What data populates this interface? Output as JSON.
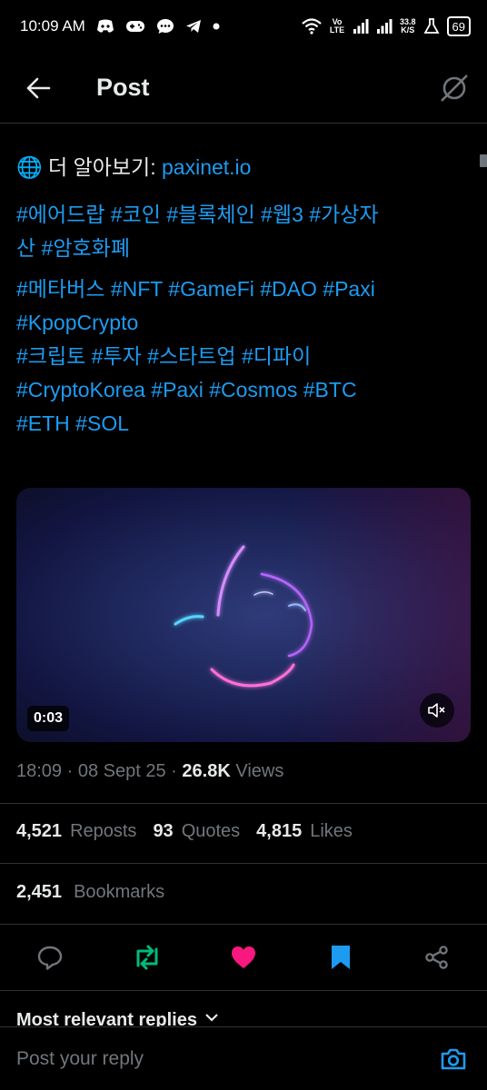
{
  "status_bar": {
    "time": "10:09 AM",
    "volte": "Vo LTE",
    "speed_value": "33.8",
    "speed_unit": "K/S",
    "battery": "69"
  },
  "header": {
    "title": "Post"
  },
  "post": {
    "learn_more_label": "🌐 더 알아보기:",
    "learn_more_link": "paxinet.io",
    "hashtag_lines": [
      "#에어드랍 #코인 #블록체인 #웹3 #가상자",
      "산 #암호화폐",
      "#메타버스 #NFT #GameFi #DAO #Paxi",
      "#KpopCrypto",
      "#크립토 #투자 #스타트업 #디파이",
      "#CryptoKorea  #Paxi #Cosmos #BTC",
      "#ETH #SOL"
    ],
    "video_duration": "0:03",
    "time": "18:09",
    "date": "08 Sept 25",
    "views_count": "26.8K",
    "views_label": "Views"
  },
  "stats": {
    "reposts_count": "4,521",
    "reposts_label": "Reposts",
    "quotes_count": "93",
    "quotes_label": "Quotes",
    "likes_count": "4,815",
    "likes_label": "Likes",
    "bookmarks_count": "2,451",
    "bookmarks_label": "Bookmarks"
  },
  "actions": [
    {
      "name": "reply",
      "icon": "reply-icon",
      "color": "#71767b"
    },
    {
      "name": "repost",
      "icon": "repost-icon",
      "color": "#00ba7c"
    },
    {
      "name": "like",
      "icon": "heart-icon",
      "color": "#f91880"
    },
    {
      "name": "bookmark",
      "icon": "bookmark-icon",
      "color": "#1d9bf0"
    },
    {
      "name": "share",
      "icon": "share-icon",
      "color": "#71767b"
    }
  ],
  "replies": {
    "header": "Most relevant replies",
    "placeholder": "Post your reply"
  },
  "colors": {
    "background": "#000000",
    "accent": "#1d9bf0",
    "muted": "#71767b",
    "repost": "#00ba7c",
    "like": "#f91880"
  }
}
